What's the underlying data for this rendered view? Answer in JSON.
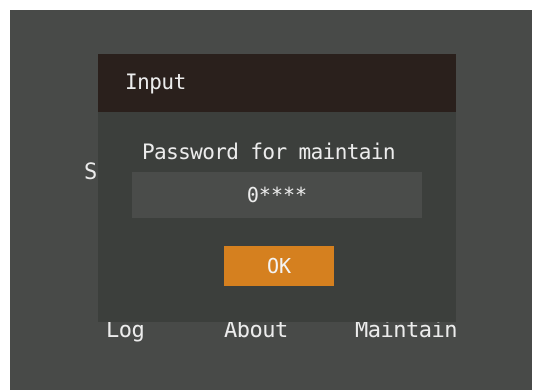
{
  "background": {
    "partial_label": "S",
    "menu": {
      "log_label": "Log",
      "about_label": "About",
      "maintain_label": "Maintain"
    }
  },
  "dialog": {
    "title": "Input",
    "prompt": "Password for maintain",
    "password_value": "0****",
    "ok_label": "OK"
  },
  "colors": {
    "screen_background": "#484a48",
    "dialog_background": "#3c3f3c",
    "title_bar": "#2a201c",
    "accent_button": "#d5801f",
    "text": "#ececec"
  }
}
